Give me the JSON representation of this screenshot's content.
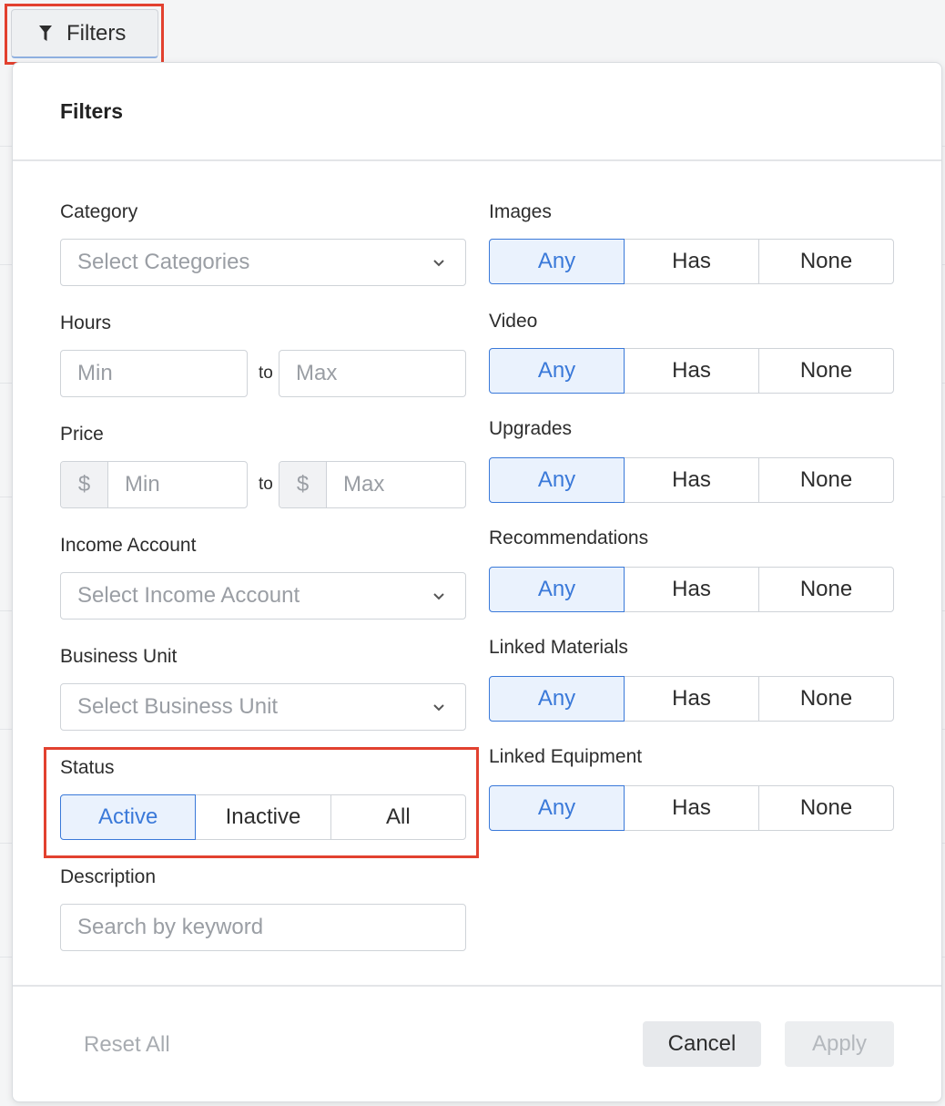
{
  "trigger": {
    "label": "Filters"
  },
  "panel": {
    "title": "Filters"
  },
  "left": {
    "category": {
      "label": "Category",
      "placeholder": "Select Categories"
    },
    "hours": {
      "label": "Hours",
      "min": "Min",
      "to": "to",
      "max": "Max"
    },
    "price": {
      "label": "Price",
      "currency": "$",
      "min": "Min",
      "to": "to",
      "max": "Max"
    },
    "income_account": {
      "label": "Income Account",
      "placeholder": "Select Income Account"
    },
    "business_unit": {
      "label": "Business Unit",
      "placeholder": "Select Business Unit"
    },
    "status": {
      "label": "Status",
      "options": [
        "Active",
        "Inactive",
        "All"
      ],
      "selected": "Active"
    },
    "description": {
      "label": "Description",
      "placeholder": "Search by keyword"
    }
  },
  "right": {
    "groups": [
      {
        "label": "Images",
        "options": [
          "Any",
          "Has",
          "None"
        ],
        "selected": "Any"
      },
      {
        "label": "Video",
        "options": [
          "Any",
          "Has",
          "None"
        ],
        "selected": "Any"
      },
      {
        "label": "Upgrades",
        "options": [
          "Any",
          "Has",
          "None"
        ],
        "selected": "Any"
      },
      {
        "label": "Recommendations",
        "options": [
          "Any",
          "Has",
          "None"
        ],
        "selected": "Any"
      },
      {
        "label": "Linked Materials",
        "options": [
          "Any",
          "Has",
          "None"
        ],
        "selected": "Any"
      },
      {
        "label": "Linked Equipment",
        "options": [
          "Any",
          "Has",
          "None"
        ],
        "selected": "Any"
      }
    ]
  },
  "footer": {
    "reset": "Reset All",
    "cancel": "Cancel",
    "apply": "Apply"
  },
  "colors": {
    "accent": "#3a79d9",
    "highlight": "#e2412f"
  },
  "icons": {
    "trigger": "filter-funnel-icon",
    "dropdown": "chevron-down-icon"
  }
}
